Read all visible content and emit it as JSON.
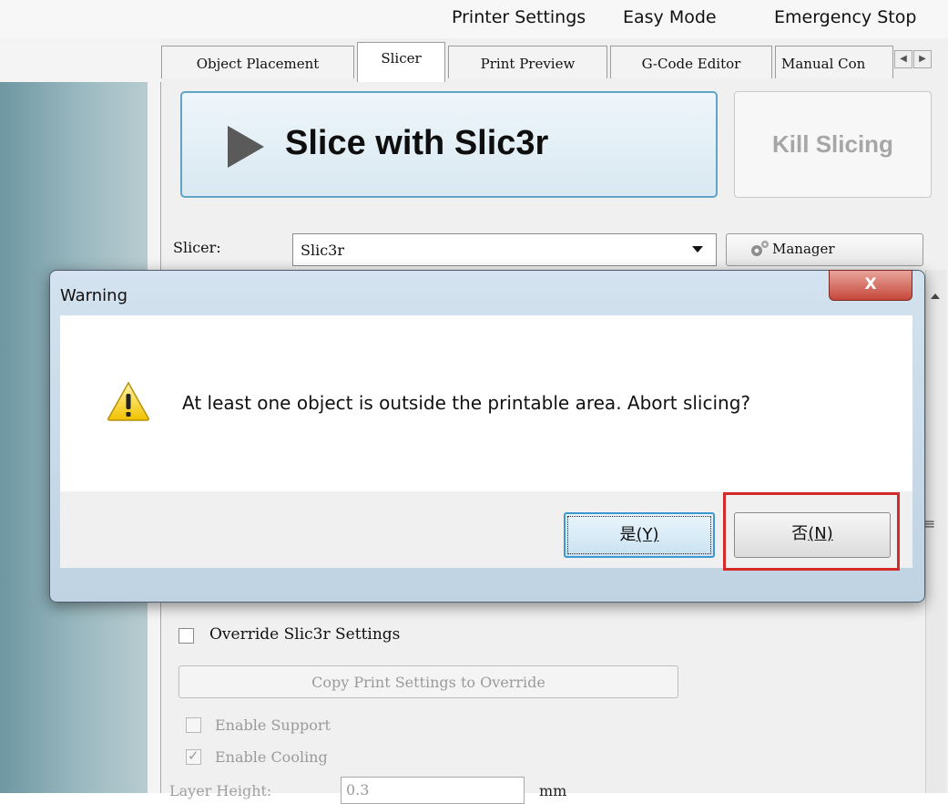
{
  "menu": {
    "printer_settings": "Printer Settings",
    "easy_mode": "Easy Mode",
    "emergency_stop": "Emergency Stop"
  },
  "tabs": [
    {
      "label": "Object Placement"
    },
    {
      "label": "Slicer"
    },
    {
      "label": "Print Preview"
    },
    {
      "label": "G-Code Editor"
    },
    {
      "label": "Manual Con"
    }
  ],
  "slicer_panel": {
    "slice_button": "Slice with Slic3r",
    "kill_button": "Kill Slicing",
    "slicer_label": "Slicer:",
    "slicer_value": "Slic3r",
    "manager_button": "Manager",
    "override_label": "Override Slic3r Settings",
    "copy_button": "Copy Print Settings to Override",
    "enable_support": "Enable Support",
    "enable_cooling": "Enable Cooling",
    "layer_height_label": "Layer Height:",
    "layer_height_value": "0.3",
    "layer_height_unit": "mm"
  },
  "dialog": {
    "title": "Warning",
    "close": "X",
    "message": "At least one object is outside the printable area. Abort slicing?",
    "yes_button": "是",
    "yes_key": "(Y)",
    "no_button": "否",
    "no_key": "(N)"
  },
  "colors": {
    "highlight_border": "#d32a2a",
    "slice_button_border": "#5fa3c6",
    "close_button": "#c5473a"
  }
}
